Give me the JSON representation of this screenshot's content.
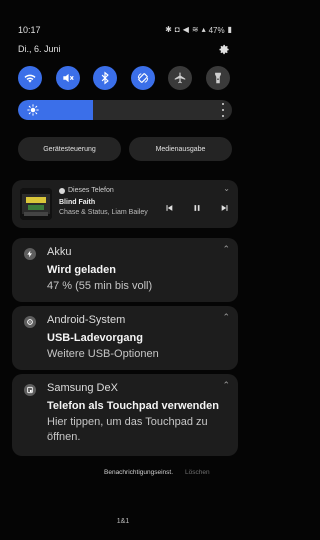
{
  "status_bar": {
    "time": "10:17",
    "battery_text": "47%",
    "icons": [
      "bluetooth-icon",
      "notification-icon",
      "mute-icon",
      "wifi-icon",
      "signal-icon",
      "battery-icon"
    ]
  },
  "date": "Di., 6. Juni",
  "quick_toggles": [
    {
      "name": "wifi-icon",
      "active": true
    },
    {
      "name": "sound-off-icon",
      "active": true
    },
    {
      "name": "bluetooth-icon",
      "active": true
    },
    {
      "name": "auto-rotate-icon",
      "active": true
    },
    {
      "name": "airplane-icon",
      "active": false
    },
    {
      "name": "flashlight-icon",
      "active": false
    }
  ],
  "brightness": {
    "level": 0.35
  },
  "buttons": {
    "device_control": "Gerätesteuerung",
    "media_output": "Medienausgabe"
  },
  "media": {
    "source": "Dieses Telefon",
    "title": "Blind Faith",
    "artist": "Chase & Status, Liam Bailey"
  },
  "notifications": [
    {
      "app": "Akku",
      "title": "Wird geladen",
      "text": "47 % (55 min bis voll)",
      "icon": "bolt-icon"
    },
    {
      "app": "Android-System",
      "title": "USB-Ladevorgang",
      "text": "Weitere USB-Optionen",
      "icon": "android-icon"
    },
    {
      "app": "Samsung DeX",
      "title": "Telefon als Touchpad verwenden",
      "text": "Hier tippen, um das Touchpad zu öffnen.",
      "icon": "dex-icon"
    }
  ],
  "footer": {
    "settings_link": "Benachrichtigungseinst.",
    "clear_link": "Löschen"
  },
  "carrier": "1&1",
  "colors": {
    "accent": "#3b6fe9",
    "card": "#1d1d1d",
    "background": "#050505"
  }
}
